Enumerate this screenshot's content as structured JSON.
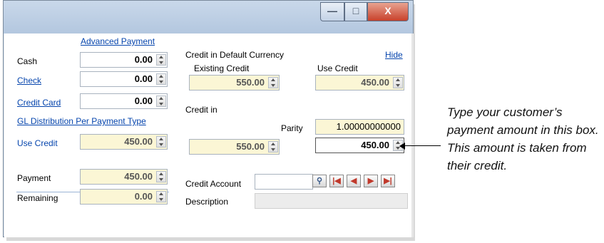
{
  "window": {
    "controls": [
      "minimize",
      "maximize",
      "close"
    ],
    "minimize_glyph": "—",
    "maximize_glyph": "□",
    "close_glyph": "X"
  },
  "payment": {
    "advanced_payment_link": "Advanced Payment",
    "cash_label": "Cash",
    "cash_value": "0.00",
    "check_label": "Check",
    "check_value": "0.00",
    "credit_card_label": "Credit Card",
    "credit_card_value": "0.00",
    "gl_distribution_link": "GL Distribution Per Payment Type",
    "use_credit_label": "Use Credit",
    "use_credit_value": "450.00",
    "payment_label": "Payment",
    "payment_value": "450.00",
    "remaining_label": "Remaining",
    "remaining_value": "0.00"
  },
  "credit": {
    "default_currency_label": "Credit in Default Currency",
    "hide_link": "Hide",
    "existing_credit_label": "Existing Credit",
    "existing_credit_value": "550.00",
    "use_credit_label": "Use Credit",
    "use_credit_value": "450.00",
    "credit_in_label": "Credit in",
    "parity_label": "Parity",
    "parity_value": "1.00000000000",
    "credit_in_existing_value": "550.00",
    "credit_in_use_value": "450.00",
    "credit_account_label": "Credit Account",
    "credit_account_value": "",
    "description_label": "Description",
    "description_value": ""
  },
  "nav_icons": [
    "lookup-icon",
    "first-record-icon",
    "previous-record-icon",
    "next-record-icon",
    "last-record-icon"
  ],
  "callout": {
    "text": "Type your customer’s payment amount in this box. This amount is taken from their credit."
  },
  "colors": {
    "link": "#0645ad",
    "readonly_field": "#fbf6d5",
    "close_button": "#c8412b",
    "titlebar": "#b3c7df"
  }
}
